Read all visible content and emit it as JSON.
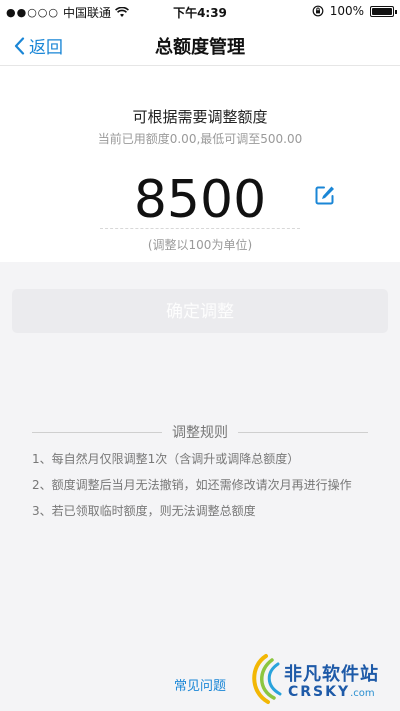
{
  "status_bar": {
    "carrier": "中国联通",
    "time": "下午4:39",
    "battery": "100%"
  },
  "nav": {
    "back_label": "返回",
    "title": "总额度管理"
  },
  "card": {
    "headline": "可根据需要调整额度",
    "subline": "当前已用额度0.00,最低可调至500.00",
    "amount": "8500",
    "unit_hint": "(调整以100为单位)"
  },
  "confirm_button": {
    "label": "确定调整"
  },
  "rules": {
    "title": "调整规则",
    "items": [
      "1、每自然月仅限调整1次（含调升或调降总额度）",
      "2、额度调整后当月无法撤销，如还需修改请次月再进行操作",
      "3、若已领取临时额度，则无法调整总额度"
    ]
  },
  "footer": {
    "faq_label": "常见问题"
  },
  "watermark": {
    "cn": "非凡软件站",
    "en": "CRSKY",
    "domain": ".com"
  },
  "colors": {
    "accent": "#1a86d6",
    "disabled_button": "#ebebee",
    "background": "#f4f4f6"
  },
  "icons": [
    "wifi-icon",
    "chevron-left-icon",
    "edit-icon",
    "orientation-lock-icon",
    "battery-icon"
  ]
}
